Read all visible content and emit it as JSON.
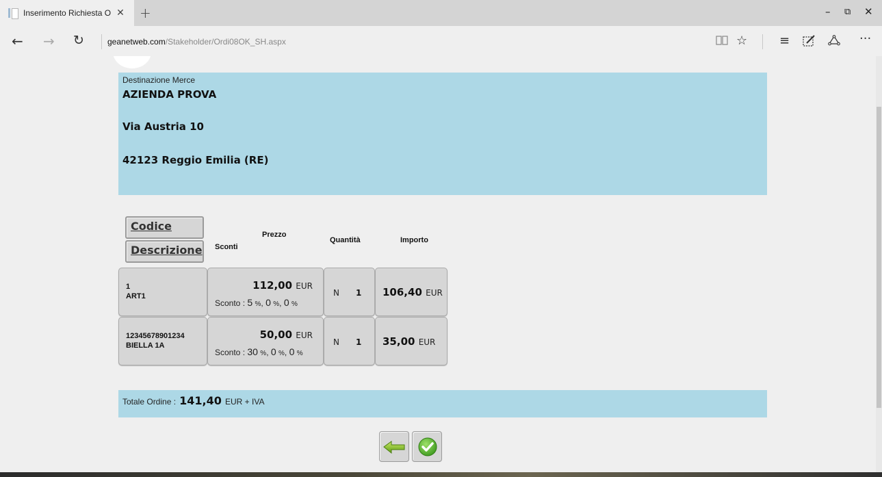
{
  "browser": {
    "tab_title": "Inserimento Richiesta O",
    "tab_close": "✕",
    "new_tab": "+",
    "url_domain": "geanetweb.com",
    "url_path": "/Stakeholder/Ordi08OK_SH.aspx",
    "window_controls": {
      "minimize": "–",
      "restore": "⧉",
      "close": "✕"
    },
    "icons": [
      "back-icon",
      "forward-icon",
      "refresh-icon",
      "reading-view-icon",
      "favorite-star-icon",
      "hub-icon",
      "web-note-icon",
      "share-icon",
      "more-icon"
    ]
  },
  "destination": {
    "label": "Destinazione Merce",
    "company": "AZIENDA PROVA",
    "street": "Via Austria 10",
    "city": "42123 Reggio Emilia (RE)"
  },
  "table": {
    "sort_buttons": {
      "code": "Codice",
      "description": "Descrizione"
    },
    "headers": {
      "discounts": "Sconti",
      "price": "Prezzo",
      "quantity": "Quantità",
      "amount": "Importo"
    },
    "rows": [
      {
        "code": "1",
        "description": "ART1",
        "price": "112,00",
        "currency": "EUR",
        "discount_label": "Sconto :",
        "discount_1": "5",
        "discount_2": "0",
        "discount_3": "0",
        "unit": "N",
        "quantity": "1",
        "amount": "106,40"
      },
      {
        "code": "12345678901234",
        "description": "BIELLA 1A",
        "price": "50,00",
        "currency": "EUR",
        "discount_label": "Sconto :",
        "discount_1": "30",
        "discount_2": "0",
        "discount_3": "0",
        "unit": "N",
        "quantity": "1",
        "amount": "35,00"
      }
    ]
  },
  "total": {
    "label": "Totale Ordine :",
    "value": "141,40",
    "suffix": "EUR + IVA"
  },
  "actions": [
    "back-arrow-icon",
    "confirm-check-icon"
  ],
  "colors": {
    "panel": "#add8e6",
    "button": "#d6d6d6",
    "page_bg": "#efefef"
  }
}
